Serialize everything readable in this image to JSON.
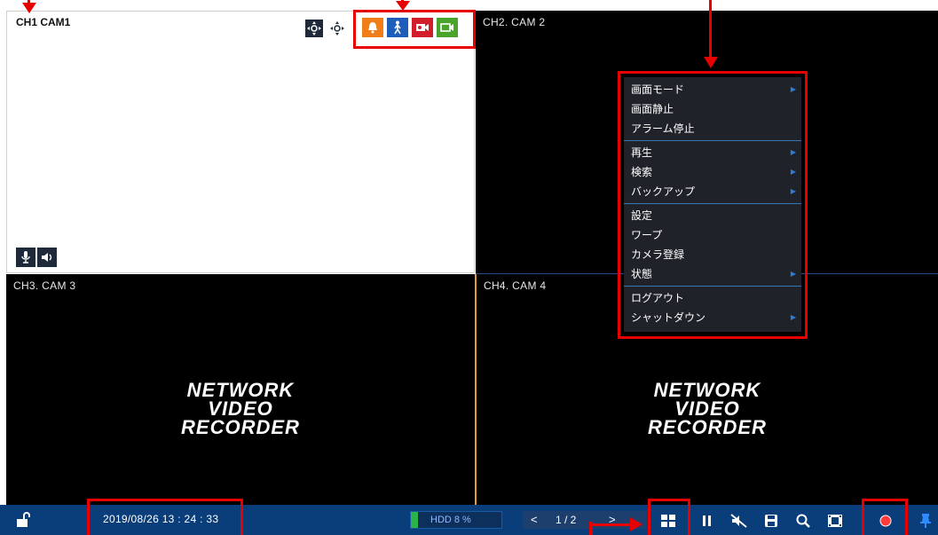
{
  "panes": {
    "ch1": {
      "label": "CH1 CAM1"
    },
    "ch2": {
      "label": "CH2. CAM 2"
    },
    "ch3": {
      "label": "CH3. CAM 3",
      "logo": [
        "NETWORK",
        "VIDEO",
        "RECORDER"
      ]
    },
    "ch4": {
      "label": "CH4. CAM 4",
      "logo": [
        "NETWORK",
        "VIDEO",
        "RECORDER"
      ]
    }
  },
  "context_menu": {
    "groups": [
      [
        {
          "label": "画面モード",
          "submenu": true
        },
        {
          "label": "画面静止",
          "submenu": false
        },
        {
          "label": "アラーム停止",
          "submenu": false
        }
      ],
      [
        {
          "label": "再生",
          "submenu": true
        },
        {
          "label": "検索",
          "submenu": true
        },
        {
          "label": "バックアップ",
          "submenu": true
        }
      ],
      [
        {
          "label": "設定",
          "submenu": false
        },
        {
          "label": "ワープ",
          "submenu": false
        },
        {
          "label": "カメラ登録",
          "submenu": false
        },
        {
          "label": "状態",
          "submenu": true
        }
      ],
      [
        {
          "label": "ログアウト",
          "submenu": false
        },
        {
          "label": "シャットダウン",
          "submenu": true
        }
      ]
    ]
  },
  "taskbar": {
    "datetime": "2019/08/26 13 : 24 : 33",
    "hdd": "HDD  8 %",
    "hdd_fill": 0.08,
    "page": "1 / 2",
    "prev": "<",
    "next": ">"
  },
  "icons": {
    "ptz": "ptz-move-icon",
    "alarm": "bell-alarm-icon",
    "motion": "motion-person-icon",
    "record_event": "record-event-icon",
    "camera": "video-camera-icon",
    "mic": "microphone-icon",
    "speaker": "speaker-icon",
    "lock": "unlock-icon"
  },
  "colors": {
    "highlight": "#e60000",
    "taskbar": "#0a3e7a",
    "alarm_icon_bg": "#ef7d1a",
    "motion_icon_bg": "#1f5dbb",
    "record_icon_bg": "#d21e2a",
    "camera_icon_bg": "#4aa32a",
    "selected_border": "#4b9be8",
    "pane_divider": "#e89a3a"
  }
}
